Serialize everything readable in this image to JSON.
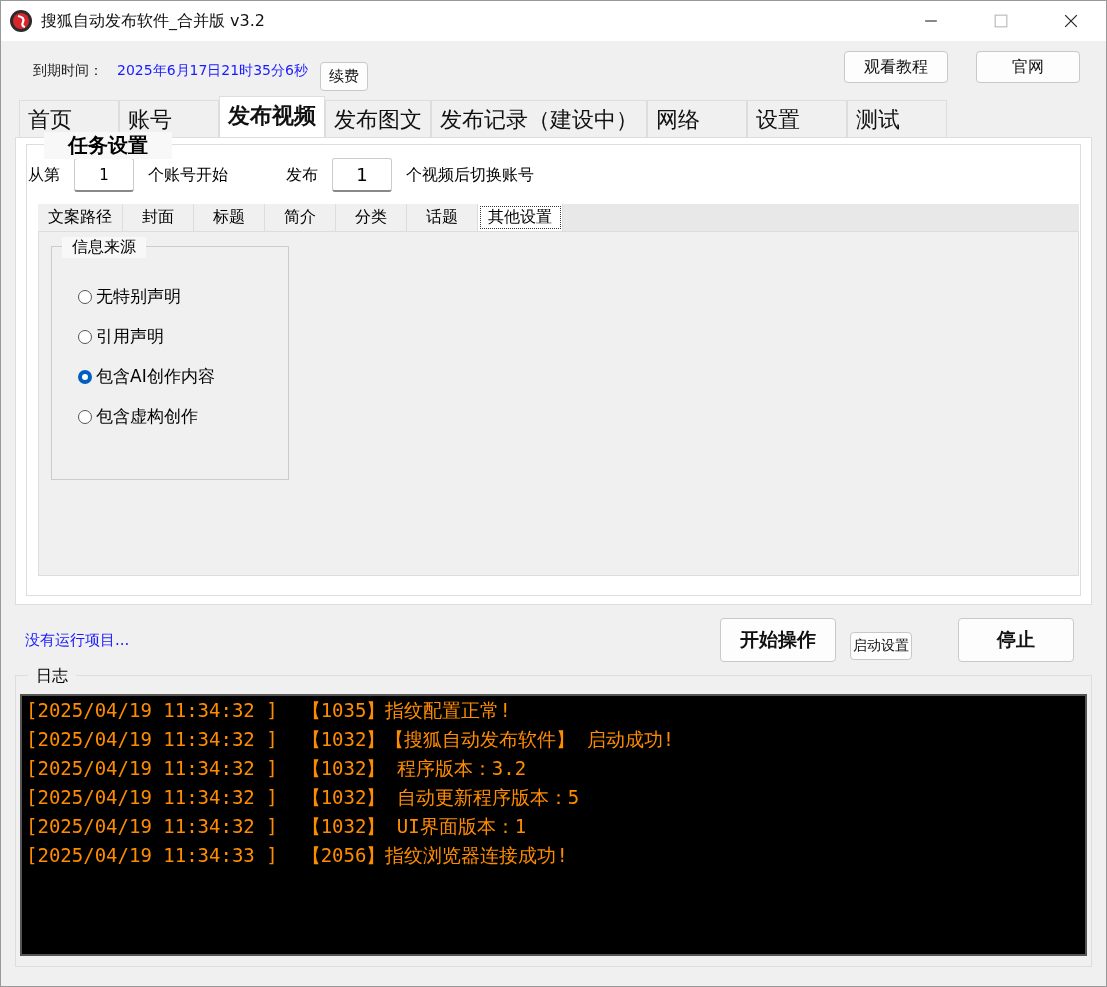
{
  "window": {
    "title": "搜狐自动发布软件_合并版  v3.2"
  },
  "header": {
    "expiry_label": "到期时间：",
    "expiry_value": "2025年6月17日21时35分6秒",
    "renew_button": "续费",
    "buttons": [
      "观看教程",
      "官网"
    ]
  },
  "tabs": [
    {
      "label": "首页",
      "selected": false
    },
    {
      "label": "账号",
      "selected": false
    },
    {
      "label": "发布视频",
      "selected": true
    },
    {
      "label": "发布图文",
      "selected": false
    },
    {
      "label": "发布记录（建设中）",
      "selected": false
    },
    {
      "label": "网络",
      "selected": false
    },
    {
      "label": "设置",
      "selected": false
    },
    {
      "label": "测试",
      "selected": false
    }
  ],
  "task_settings": {
    "title": "任务设置",
    "start_prefix": "从第",
    "start_value": "1",
    "start_suffix": "个账号开始",
    "switch_prefix": "发布",
    "switch_value": "1",
    "switch_suffix": "个视频后切换账号",
    "subtabs": [
      {
        "label": "文案路径",
        "selected": false
      },
      {
        "label": "封面",
        "selected": false
      },
      {
        "label": "标题",
        "selected": false
      },
      {
        "label": "简介",
        "selected": false
      },
      {
        "label": "分类",
        "selected": false
      },
      {
        "label": "话题",
        "selected": false
      },
      {
        "label": "其他设置",
        "selected": true
      }
    ],
    "source_group": {
      "title": "信息来源",
      "options": [
        {
          "label": "无特别声明",
          "selected": false
        },
        {
          "label": "引用声明",
          "selected": false
        },
        {
          "label": "包含AI创作内容",
          "selected": true
        },
        {
          "label": "包含虚构创作",
          "selected": false
        }
      ]
    }
  },
  "status": "没有运行项目...",
  "actions": {
    "start": "开始操作",
    "startup_settings": "启动设置",
    "stop": "停止"
  },
  "log": {
    "title": "日志",
    "lines": [
      {
        "time": "[2025/04/19 11:34:32 ]",
        "message": "【1035】指纹配置正常!"
      },
      {
        "time": "[2025/04/19 11:34:32 ]",
        "message": "【1032】【搜狐自动发布软件】 启动成功!"
      },
      {
        "time": "[2025/04/19 11:34:32 ]",
        "message": "【1032】 程序版本：3.2"
      },
      {
        "time": "[2025/04/19 11:34:32 ]",
        "message": "【1032】 自动更新程序版本：5"
      },
      {
        "time": "[2025/04/19 11:34:32 ]",
        "message": "【1032】 UI界面版本：1"
      },
      {
        "time": "[2025/04/19 11:34:33 ]",
        "message": "【2056】指纹浏览器连接成功!"
      }
    ]
  }
}
